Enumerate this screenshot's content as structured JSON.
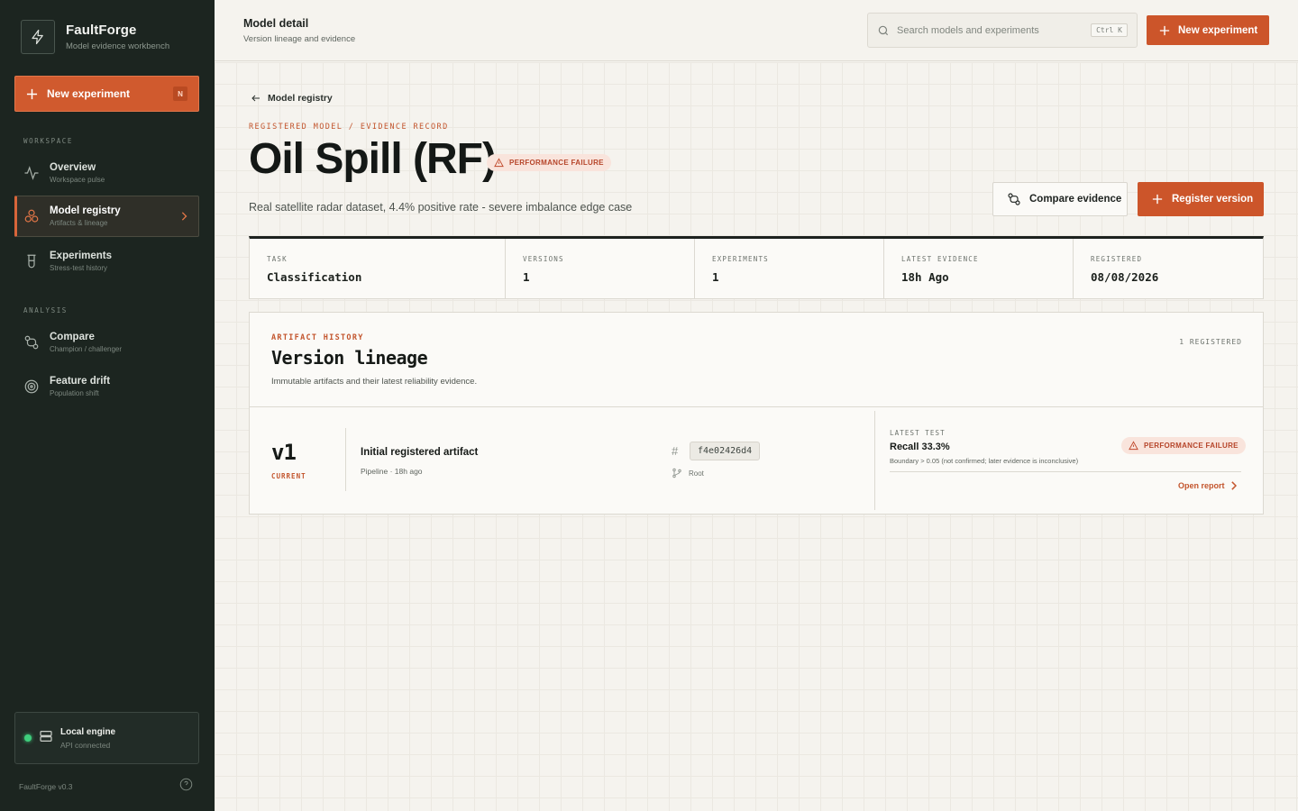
{
  "app": {
    "name": "FaultForge",
    "tagline": "Model evidence workbench",
    "version": "FaultForge v0.3"
  },
  "sidebar": {
    "new_button": {
      "label": "New experiment",
      "shortcut": "N"
    },
    "sections": [
      {
        "title": "WORKSPACE"
      },
      {
        "title": "ANALYSIS"
      }
    ],
    "items": [
      {
        "title": "Overview",
        "subtitle": "Workspace pulse",
        "icon": "activity-icon"
      },
      {
        "title": "Model registry",
        "subtitle": "Artifacts & lineage",
        "icon": "registry-icon",
        "active": true
      },
      {
        "title": "Experiments",
        "subtitle": "Stress-test history",
        "icon": "flask-icon"
      },
      {
        "title": "Compare",
        "subtitle": "Champion / challenger",
        "icon": "compare-icon"
      },
      {
        "title": "Feature drift",
        "subtitle": "Population shift",
        "icon": "target-icon"
      }
    ],
    "engine": {
      "title": "Local engine",
      "status": "API connected",
      "status_color": "#3fce7c"
    }
  },
  "topbar": {
    "title": "Model detail",
    "subtitle": "Version lineage and evidence",
    "search_placeholder": "Search models and experiments",
    "search_shortcut": "Ctrl K",
    "new_button_label": "New experiment"
  },
  "breadcrumb": {
    "back_label": "Model registry"
  },
  "model": {
    "eyebrow": "REGISTERED MODEL / EVIDENCE RECORD",
    "name": "Oil Spill (RF)",
    "status_badge": "PERFORMANCE FAILURE",
    "description": "Real satellite radar dataset, 4.4% positive rate - severe imbalance edge case",
    "actions": {
      "compare": "Compare evidence",
      "register": "Register version"
    }
  },
  "stats": [
    {
      "label": "TASK",
      "value": "Classification"
    },
    {
      "label": "VERSIONS",
      "value": "1"
    },
    {
      "label": "EXPERIMENTS",
      "value": "1"
    },
    {
      "label": "LATEST EVIDENCE",
      "value": "18h Ago"
    },
    {
      "label": "REGISTERED",
      "value": "08/08/2026"
    }
  ],
  "lineage": {
    "eyebrow": "ARTIFACT HISTORY",
    "title": "Version lineage",
    "subtitle": "Immutable artifacts and their latest reliability evidence.",
    "count": "1 REGISTERED",
    "versions": [
      {
        "tag": "v1",
        "state": "CURRENT",
        "name": "Initial registered artifact",
        "meta": "Pipeline · 18h ago",
        "hash": "f4e02426d4",
        "parent": "Root",
        "evidence": {
          "label": "LATEST TEST",
          "metric": "Recall 33.3%",
          "boundary": "Boundary > 0.05 (not confirmed; later evidence is inconclusive)",
          "badge": "PERFORMANCE FAILURE",
          "link": "Open report"
        }
      }
    ]
  },
  "colors": {
    "accent": "#cc552a",
    "sidebar_bg": "#1c2520",
    "failure_bg": "#f9e4dc",
    "failure_text": "#b6452a"
  }
}
